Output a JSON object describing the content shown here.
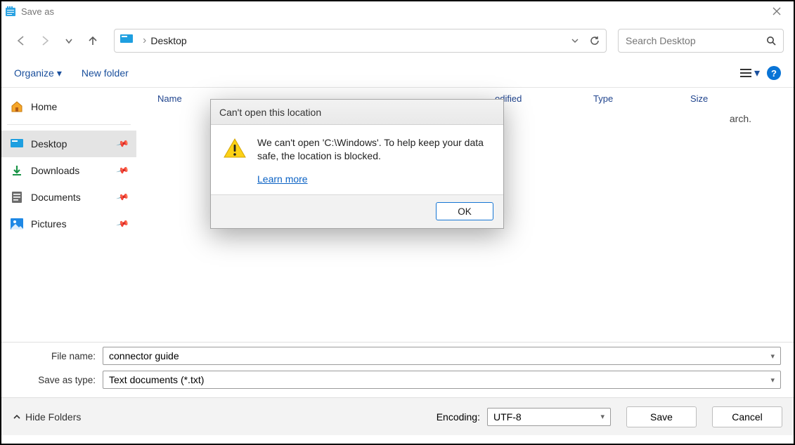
{
  "window": {
    "title": "Save as"
  },
  "breadcrumb": {
    "location": "Desktop"
  },
  "search": {
    "placeholder": "Search Desktop"
  },
  "toolbar": {
    "organize": "Organize",
    "new_folder": "New folder"
  },
  "sidebar": {
    "home": "Home",
    "items": [
      {
        "label": "Desktop"
      },
      {
        "label": "Downloads"
      },
      {
        "label": "Documents"
      },
      {
        "label": "Pictures"
      }
    ]
  },
  "columns": {
    "name": "Name",
    "date": "odified",
    "type": "Type",
    "size": "Size"
  },
  "content_hint": "arch.",
  "form": {
    "filename_label": "File name:",
    "filename_value": "connector guide",
    "type_label": "Save as type:",
    "type_value": "Text documents (*.txt)"
  },
  "footer": {
    "hide_folders": "Hide Folders",
    "encoding_label": "Encoding:",
    "encoding_value": "UTF-8",
    "save": "Save",
    "cancel": "Cancel"
  },
  "dialog": {
    "title": "Can't open this location",
    "message": "We can't open 'C:\\Windows'. To help keep your data safe, the location is blocked.",
    "learn_more": "Learn more",
    "ok": "OK"
  }
}
